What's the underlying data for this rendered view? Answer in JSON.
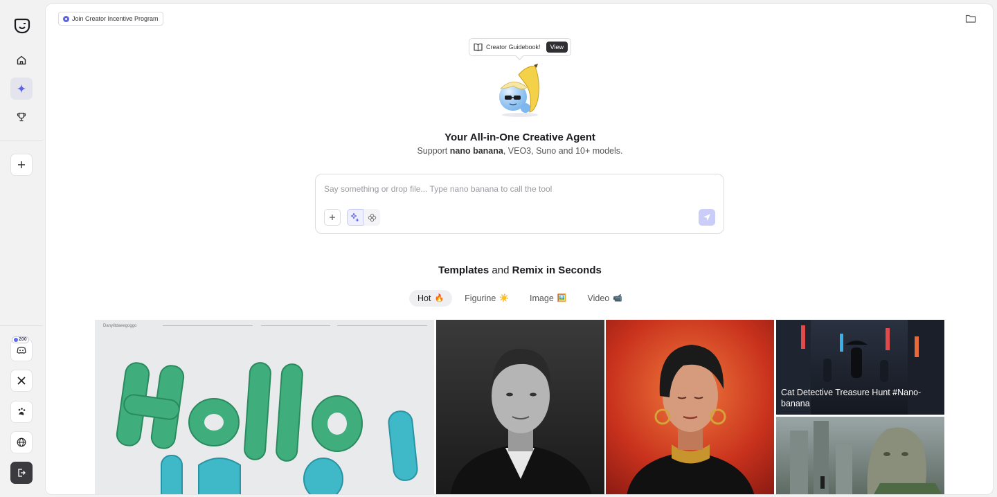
{
  "promo": {
    "label": "Join Creator Incentive Program"
  },
  "guide": {
    "label": "Creator Guidebook!",
    "view": "View"
  },
  "hero": {
    "title": "Your All-in-One Creative Agent",
    "sub_prefix": "Support ",
    "sub_bold": "nano banana",
    "sub_suffix": ", VEO3, Suno and 10+ models."
  },
  "composer": {
    "placeholder": "Say something or drop file... Type nano banana to call the tool",
    "value": ""
  },
  "templates": {
    "title_part1": "Templates",
    "title_and": " and ",
    "title_part2": "Remix in Seconds",
    "tabs": [
      {
        "label": "Hot",
        "emoji": "🔥"
      },
      {
        "label": "Figurine",
        "emoji": "☀️"
      },
      {
        "label": "Image",
        "emoji": "🖼️"
      },
      {
        "label": "Video",
        "emoji": "📹"
      }
    ],
    "tiles": {
      "t1_small": "Danyiitdaeegoggo",
      "t4_caption": "Cat Detective Treasure Hunt #Nano-banana"
    }
  },
  "sidebar": {
    "badge": "200"
  },
  "colors": {
    "accent": "#5b63e8",
    "send": "#c9cdf8"
  }
}
